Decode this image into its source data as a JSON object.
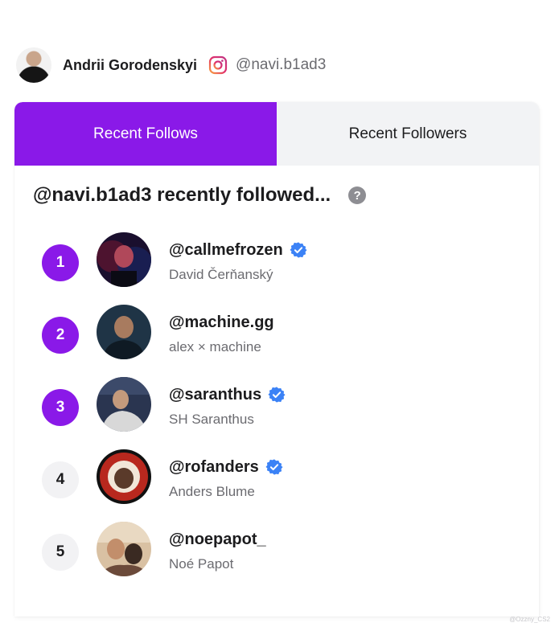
{
  "profile": {
    "name": "Andrii Gorodenskyi",
    "handle": "@navi.b1ad3",
    "platform_icon": "instagram-icon"
  },
  "tabs": [
    {
      "label": "Recent Follows",
      "active": true
    },
    {
      "label": "Recent Followers",
      "active": false
    }
  ],
  "section": {
    "title": "@navi.b1ad3 recently followed...",
    "help_icon": "question-icon"
  },
  "follows": [
    {
      "rank": "1",
      "handle": "@callmefrozen",
      "name": "David Čerňanský",
      "verified": true
    },
    {
      "rank": "2",
      "handle": "@machine.gg",
      "name": "alex × machine",
      "verified": false
    },
    {
      "rank": "3",
      "handle": "@saranthus",
      "name": "SH Saranthus",
      "verified": true
    },
    {
      "rank": "4",
      "handle": "@rofanders",
      "name": "Anders Blume",
      "verified": true
    },
    {
      "rank": "5",
      "handle": "@noepapot_",
      "name": "Noé Papot",
      "verified": false
    }
  ],
  "watermark": "@Ozzny_CS2",
  "colors": {
    "accent": "#8a19e8",
    "verified": "#3b82f6",
    "tab_inactive_bg": "#f2f3f5"
  }
}
